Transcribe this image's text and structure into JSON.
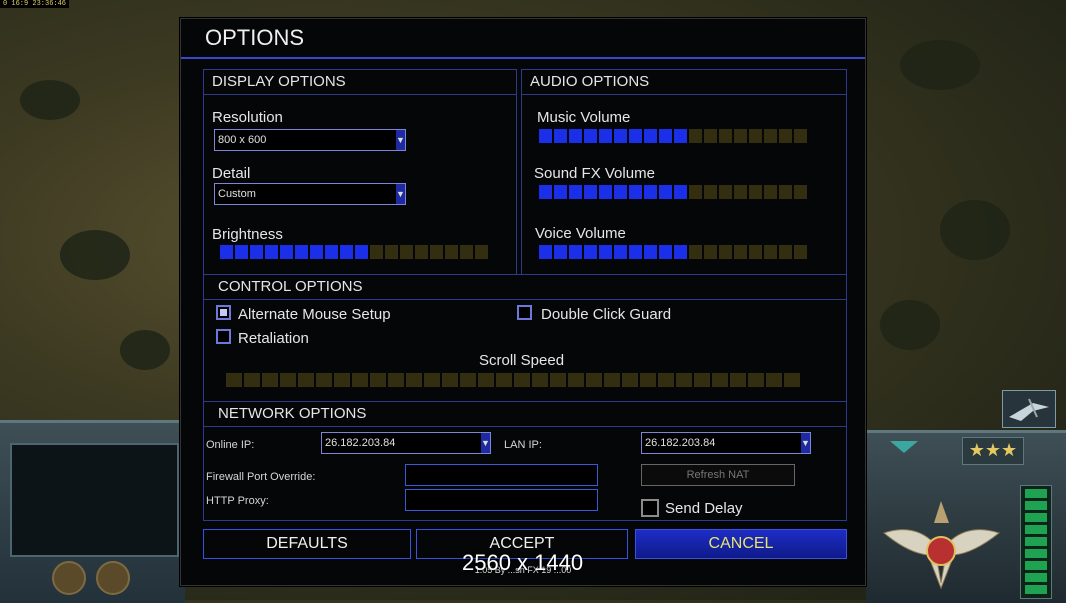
{
  "top_info": "0 16:9  23:36:46",
  "dialog": {
    "title": "OPTIONS",
    "display": {
      "heading": "DISPLAY OPTIONS",
      "resolution_label": "Resolution",
      "resolution_value": "800 x 600",
      "detail_label": "Detail",
      "detail_value": "Custom",
      "brightness_label": "Brightness",
      "brightness_level": 10,
      "brightness_segments": 18
    },
    "audio": {
      "heading": "AUDIO OPTIONS",
      "music_label": "Music Volume",
      "music_level": 10,
      "sfx_label": "Sound FX Volume",
      "sfx_level": 10,
      "voice_label": "Voice Volume",
      "voice_level": 10,
      "segments": 18
    },
    "control": {
      "heading": "CONTROL OPTIONS",
      "alt_mouse_label": "Alternate Mouse Setup",
      "alt_mouse_checked": true,
      "retaliation_label": "Retaliation",
      "retaliation_checked": false,
      "double_click_label": "Double Click Guard",
      "double_click_checked": false,
      "scroll_label": "Scroll Speed",
      "scroll_level": 0,
      "scroll_segments": 32
    },
    "network": {
      "heading": "NETWORK OPTIONS",
      "online_ip_label": "Online IP:",
      "online_ip_value": "26.182.203.84",
      "lan_ip_label": "LAN IP:",
      "lan_ip_value": "26.182.203.84",
      "firewall_label": "Firewall Port Override:",
      "http_proxy_label": "HTTP Proxy:",
      "refresh_nat_label": "Refresh NAT",
      "send_delay_label": "Send Delay",
      "send_delay_checked": false
    },
    "buttons": {
      "defaults": "DEFAULTS",
      "accept": "ACCEPT",
      "cancel": "CANCEL"
    },
    "version": "1.05 By ...sh  FX 19 ...00"
  },
  "overlay_text": "2560 x 1440",
  "colors": {
    "slider_on": "#1b2ee8",
    "slider_off": "#342e10",
    "accent_border": "#3b46c8",
    "cancel_text": "#e9e36c"
  }
}
